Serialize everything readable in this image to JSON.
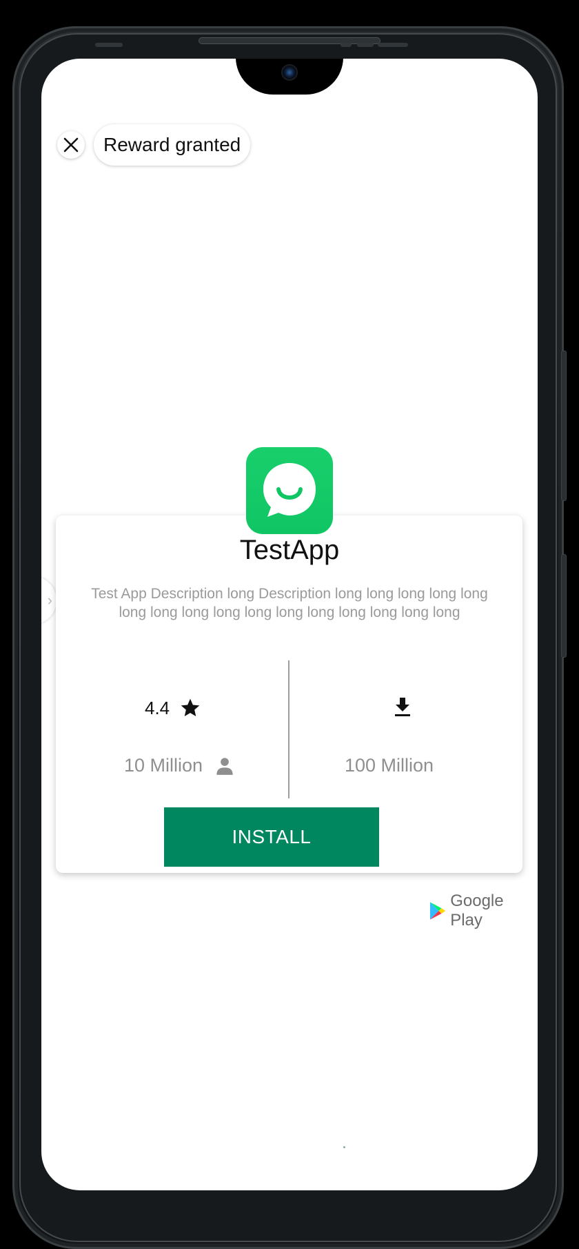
{
  "topbar": {
    "close_icon": "close-icon",
    "reward_label": "Reward granted"
  },
  "app": {
    "icon": "chat-bubble-smile-icon",
    "icon_color": "#19cf6c",
    "name": "TestApp",
    "description": "Test App Description long Description long long long long long long long long long long long long long long long long"
  },
  "stats": {
    "rating": "4.4",
    "rating_icon": "star-icon",
    "reviews": "10 Million",
    "reviews_icon": "person-icon",
    "download_icon": "download-icon",
    "downloads": "100 Million"
  },
  "install": {
    "label": "INSTALL",
    "color": "#01875f"
  },
  "store": {
    "label": "Google Play",
    "icon": "google-play-icon"
  }
}
